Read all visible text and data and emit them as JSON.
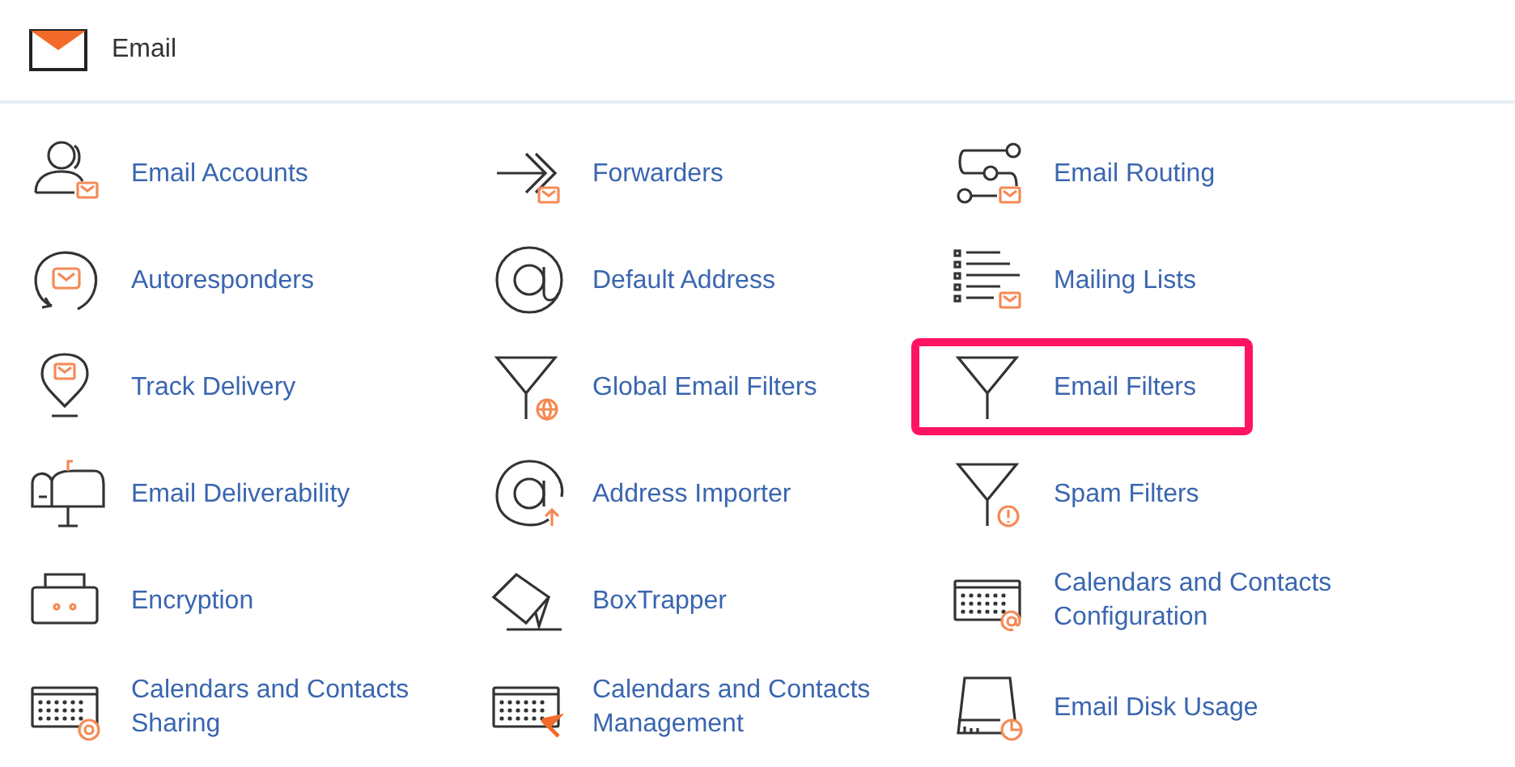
{
  "header": {
    "title": "Email"
  },
  "rows": [
    {
      "items": [
        {
          "label": "Email Accounts",
          "highlighted": false
        },
        {
          "label": "Forwarders",
          "highlighted": false
        },
        {
          "label": "Email Routing",
          "highlighted": false
        }
      ]
    },
    {
      "items": [
        {
          "label": "Autoresponders",
          "highlighted": false
        },
        {
          "label": "Default Address",
          "highlighted": false
        },
        {
          "label": "Mailing Lists",
          "highlighted": false
        }
      ]
    },
    {
      "items": [
        {
          "label": "Track Delivery",
          "highlighted": false
        },
        {
          "label": "Global Email Filters",
          "highlighted": false
        },
        {
          "label": "Email Filters",
          "highlighted": true
        }
      ]
    },
    {
      "items": [
        {
          "label": "Email Deliverability",
          "highlighted": false
        },
        {
          "label": "Address Importer",
          "highlighted": false
        },
        {
          "label": "Spam Filters",
          "highlighted": false
        }
      ]
    },
    {
      "items": [
        {
          "label": "Encryption",
          "highlighted": false
        },
        {
          "label": "BoxTrapper",
          "highlighted": false
        },
        {
          "label": "Calendars and Contacts Configuration",
          "highlighted": false
        }
      ]
    },
    {
      "items": [
        {
          "label": "Calendars and Contacts Sharing",
          "highlighted": false
        },
        {
          "label": "Calendars and Contacts Management",
          "highlighted": false
        },
        {
          "label": "Email Disk Usage",
          "highlighted": false
        }
      ]
    }
  ]
}
